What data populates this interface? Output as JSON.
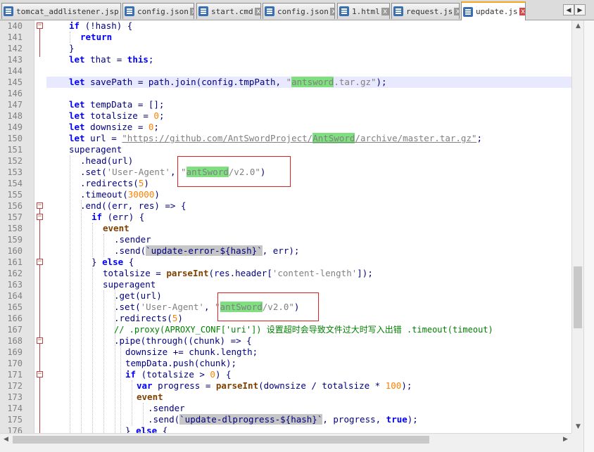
{
  "tabs": [
    {
      "label": "tomcat_addlistener.jsp",
      "active": false
    },
    {
      "label": "config.json",
      "active": false
    },
    {
      "label": "start.cmd",
      "active": false
    },
    {
      "label": "config.json",
      "active": false
    },
    {
      "label": "1.html",
      "active": false
    },
    {
      "label": "request.js",
      "active": false
    },
    {
      "label": "update.js",
      "active": true
    }
  ],
  "tab_close_glyph": "x",
  "tab_scroll": {
    "left": "◀",
    "right": "▶"
  },
  "scrollbar": {
    "up": "▲",
    "down": "▼",
    "left": "◀",
    "right": "▶"
  },
  "colors": {
    "keyword": "#0000ff",
    "number": "#ff8000",
    "string": "#808080",
    "comment": "#008000",
    "mark": "#7fe07f",
    "active_tab_accent": "#f5a623",
    "annotation_box": "#e02020"
  },
  "code": {
    "line_numbers": [
      "140",
      "141",
      "142",
      "143",
      "144",
      "145",
      "146",
      "147",
      "148",
      "149",
      "150",
      "151",
      "152",
      "153",
      "154",
      "155",
      "156",
      "157",
      "158",
      "159",
      "160",
      "161",
      "162",
      "163",
      "164",
      "165",
      "166",
      "167",
      "168",
      "169",
      "170",
      "171",
      "172",
      "173",
      "174",
      "175",
      "176"
    ],
    "fold_lines": [
      "140",
      "156",
      "157",
      "161",
      "168",
      "171"
    ],
    "highlighted_line": "145",
    "l140": {
      "a": "if",
      "b": " (!hash) {"
    },
    "l141": {
      "a": "return"
    },
    "l142": {
      "a": "}"
    },
    "l143": {
      "a": "let",
      "b": " that = ",
      "c": "this",
      "d": ";"
    },
    "l145": {
      "a": "let",
      "b": " savePath = path.join(config.tmpPath, ",
      "q1": "\"",
      "m": "antsword",
      "q2": ".tar.gz\"",
      "e": ");"
    },
    "l147": {
      "a": "let",
      "b": " tempData = [];"
    },
    "l148": {
      "a": "let",
      "b": " totalsize = ",
      "n": "0",
      "e": ";"
    },
    "l149": {
      "a": "let",
      "b": " downsize = ",
      "n": "0",
      "e": ";"
    },
    "l150": {
      "a": "let",
      "b": " url = ",
      "s1": "\"https://github.com/AntSwordProject/",
      "m": "AntSword",
      "s2": "/archive/master.tar.gz\"",
      "e": ";"
    },
    "l151": {
      "a": "superagent"
    },
    "l152": {
      "a": ".head(url)"
    },
    "l153": {
      "a": ".set(",
      "s1": "'User-Agent'",
      "b": ", ",
      "s2": "\"",
      "m": "antSword",
      "s3": "/v2.0\"",
      "e": ")"
    },
    "l154": {
      "a": ".redirects(",
      "n": "5",
      "e": ")"
    },
    "l155": {
      "a": ".timeout(",
      "n": "30000",
      "e": ")"
    },
    "l156": {
      "a": ".end((err, res) => {"
    },
    "l157": {
      "a": "if",
      "b": " (err) {"
    },
    "l158": {
      "a": "event"
    },
    "l159": {
      "a": ".sender"
    },
    "l160": {
      "a": ".send(",
      "t": "`update-error-${hash}`",
      "e": ", err);"
    },
    "l161": {
      "a": "} ",
      "k": "else",
      "e": " {"
    },
    "l162": {
      "a": "totalsize = ",
      "f": "parseInt",
      "b": "(res.header[",
      "s": "'content-length'",
      "e": "]);"
    },
    "l163": {
      "a": "superagent"
    },
    "l164": {
      "a": ".get(url)"
    },
    "l165": {
      "a": ".set(",
      "s1": "'User-Agent'",
      "b": ", ",
      "s2": "\"",
      "m": "antSword",
      "s3": "/v2.0\"",
      "e": ")"
    },
    "l166": {
      "a": ".redirects(",
      "n": "5",
      "e": ")"
    },
    "l167": {
      "a": "// .proxy(APROXY_CONF['uri']) 设置超时会导致文件过大时写入出错 .timeout(timeout)"
    },
    "l168": {
      "a": ".pipe(through((chunk) => {"
    },
    "l169": {
      "a": "downsize += chunk.length;"
    },
    "l170": {
      "a": "tempData.push(chunk);"
    },
    "l171": {
      "a": "if",
      "b": " (totalsize > ",
      "n": "0",
      "e": ") {"
    },
    "l172": {
      "a": "var",
      "b": " progress = ",
      "f": "parseInt",
      "c": "(downsize / totalsize * ",
      "n": "100",
      "e": ");"
    },
    "l173": {
      "a": "event"
    },
    "l174": {
      "a": ".sender"
    },
    "l175": {
      "a": ".send(",
      "t": "`update-dlprogress-${hash}`",
      "b": ", progress, ",
      "k": "true",
      "e": ");"
    },
    "l176": {
      "a": "} ",
      "k": "else",
      "e": " {"
    }
  }
}
